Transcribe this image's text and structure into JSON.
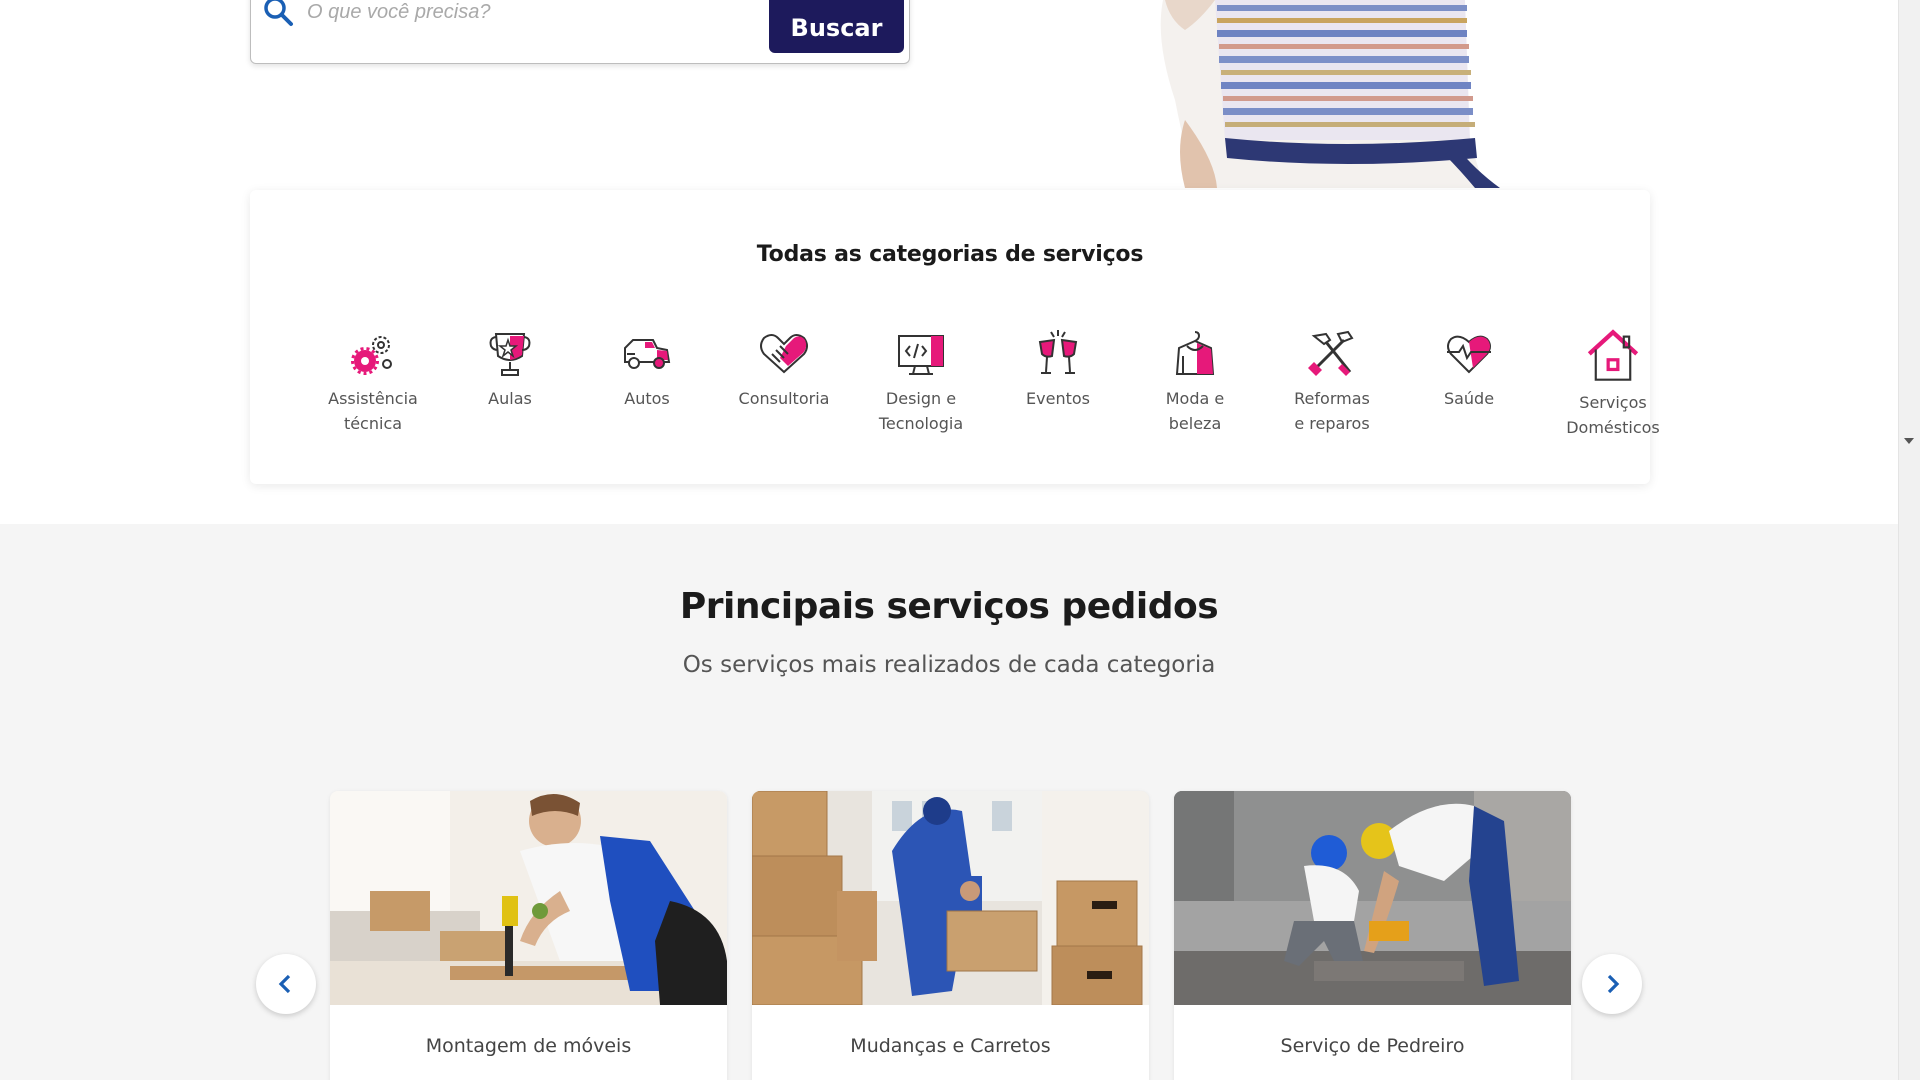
{
  "search": {
    "placeholder": "O que você precisa?",
    "button_label": "Buscar"
  },
  "categories": {
    "title": "Todas as categorias de serviços",
    "items": [
      {
        "line1": "Assistência",
        "line2": "técnica",
        "icon": "gears-icon"
      },
      {
        "line1": "Aulas",
        "line2": "",
        "icon": "trophy-icon"
      },
      {
        "line1": "Autos",
        "line2": "",
        "icon": "car-icon"
      },
      {
        "line1": "Consultoria",
        "line2": "",
        "icon": "handshake-icon"
      },
      {
        "line1": "Design e",
        "line2": "Tecnologia",
        "icon": "monitor-code-icon"
      },
      {
        "line1": "Eventos",
        "line2": "",
        "icon": "champagne-glasses-icon"
      },
      {
        "line1": "Moda e",
        "line2": "beleza",
        "icon": "clothes-hanger-icon"
      },
      {
        "line1": "Reformas",
        "line2": "e reparos",
        "icon": "hammer-screwdriver-icon"
      },
      {
        "line1": "Saúde",
        "line2": "",
        "icon": "heart-pulse-icon"
      },
      {
        "line1": "Serviços",
        "line2": "Domésticos",
        "icon": "house-icon"
      }
    ]
  },
  "popular": {
    "title": "Principais serviços pedidos",
    "subtitle": "Os serviços mais realizados de cada categoria",
    "cards": [
      {
        "label": "Montagem de móveis"
      },
      {
        "label": "Mudanças e Carretos"
      },
      {
        "label": "Serviço de Pedreiro"
      }
    ]
  },
  "colors": {
    "brand_navy": "#1d1a5c",
    "accent_pink": "#e6197a",
    "link_blue": "#1a5fb4",
    "section_bg": "#f5f5f5"
  }
}
